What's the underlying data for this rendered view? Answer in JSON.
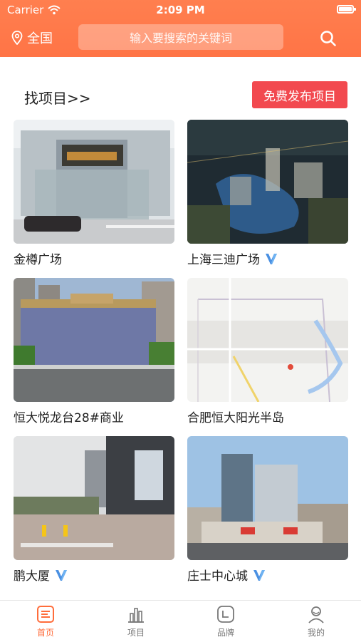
{
  "status_bar": {
    "carrier": "Carrier",
    "time": "2:09 PM"
  },
  "header": {
    "location": "全国",
    "search_placeholder": "输入要搜索的关键词"
  },
  "section": {
    "title": "找项目>>",
    "publish_button": "免费发布项目"
  },
  "projects": [
    {
      "name": "金樽广场",
      "verified": false
    },
    {
      "name": "上海三迪广场",
      "verified": true
    },
    {
      "name": "恒大悦龙台28#商业",
      "verified": false
    },
    {
      "name": "合肥恒大阳光半岛",
      "verified": false
    },
    {
      "name": "鹏大厦",
      "verified": true
    },
    {
      "name": "庄士中心城",
      "verified": true
    }
  ],
  "tabbar": {
    "tabs": [
      {
        "label": "首页",
        "active": true
      },
      {
        "label": "项目",
        "active": false
      },
      {
        "label": "品牌",
        "active": false
      },
      {
        "label": "我的",
        "active": false
      }
    ]
  },
  "colors": {
    "brand": "#ff7446",
    "publish": "#f2494f",
    "verified": "#4a90e2"
  }
}
